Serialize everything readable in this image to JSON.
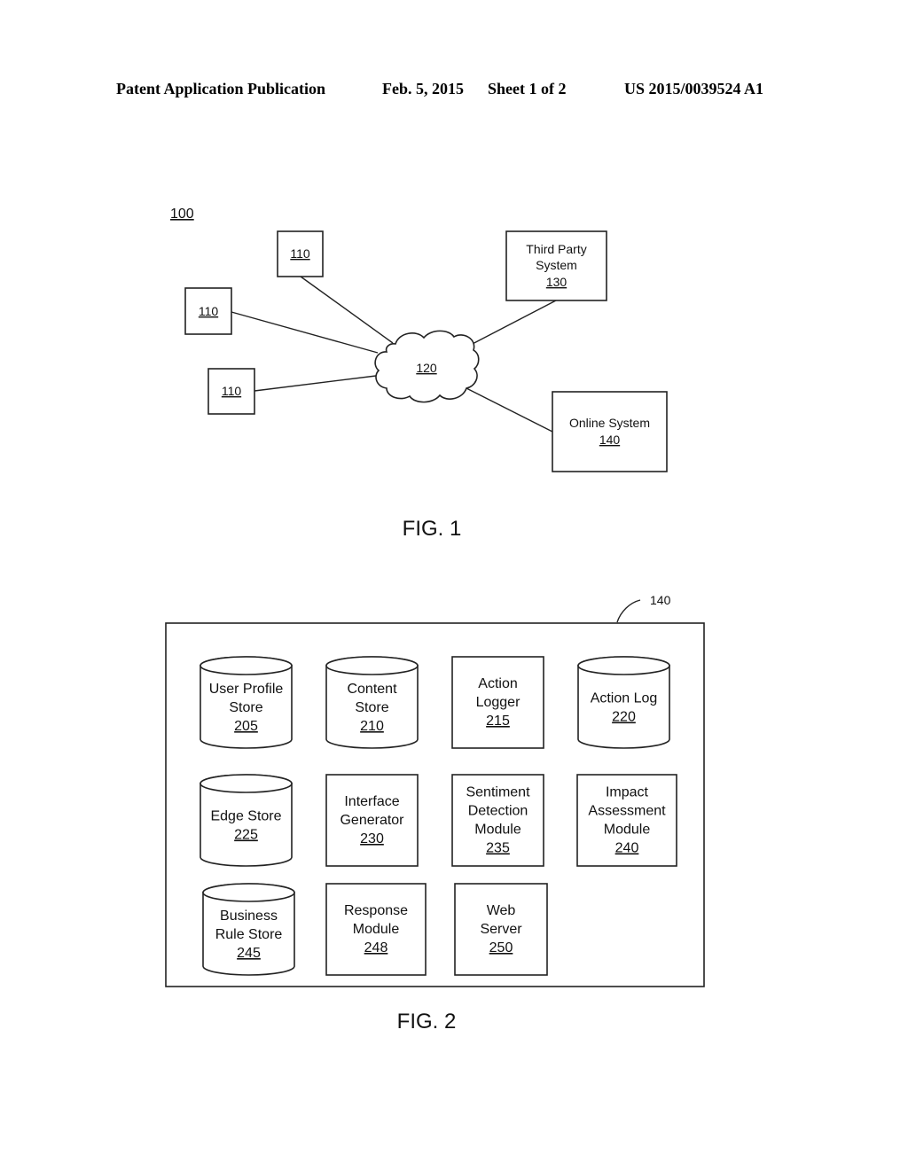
{
  "header": {
    "publication": "Patent Application Publication",
    "date": "Feb. 5, 2015",
    "sheet": "Sheet 1 of 2",
    "number": "US 2015/0039524 A1"
  },
  "fig1": {
    "system_ref": "100",
    "client_devices": [
      {
        "ref": "110"
      },
      {
        "ref": "110"
      },
      {
        "ref": "110"
      }
    ],
    "network": {
      "ref": "120"
    },
    "third_party": {
      "line1": "Third Party",
      "line2": "System",
      "ref": "130"
    },
    "online_system": {
      "line1": "Online System",
      "ref": "140"
    },
    "caption": "FIG. 1"
  },
  "fig2": {
    "container_ref": "140",
    "components": [
      {
        "type": "cylinder",
        "lines": [
          "User Profile",
          "Store"
        ],
        "ref": "205"
      },
      {
        "type": "cylinder",
        "lines": [
          "Content",
          "Store"
        ],
        "ref": "210"
      },
      {
        "type": "box",
        "lines": [
          "Action",
          "Logger"
        ],
        "ref": "215"
      },
      {
        "type": "cylinder",
        "lines": [
          "Action Log"
        ],
        "ref": "220"
      },
      {
        "type": "cylinder",
        "lines": [
          "Edge Store"
        ],
        "ref": "225"
      },
      {
        "type": "box",
        "lines": [
          "Interface",
          "Generator"
        ],
        "ref": "230"
      },
      {
        "type": "box",
        "lines": [
          "Sentiment",
          "Detection",
          "Module"
        ],
        "ref": "235"
      },
      {
        "type": "box",
        "lines": [
          "Impact",
          "Assessment",
          "Module"
        ],
        "ref": "240"
      },
      {
        "type": "cylinder",
        "lines": [
          "Business",
          "Rule Store"
        ],
        "ref": "245"
      },
      {
        "type": "box",
        "lines": [
          "Response",
          "Module"
        ],
        "ref": "248"
      },
      {
        "type": "box",
        "lines": [
          "Web",
          "Server"
        ],
        "ref": "250"
      }
    ],
    "caption": "FIG. 2"
  }
}
